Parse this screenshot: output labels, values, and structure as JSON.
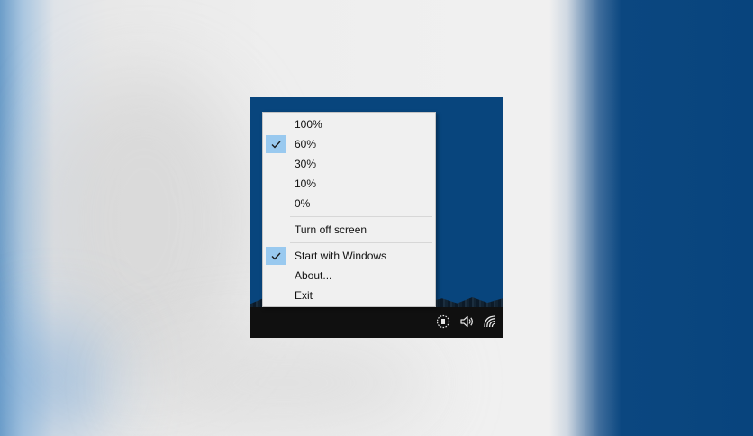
{
  "context_menu": {
    "brightness_options": [
      {
        "label": "100%",
        "checked": false
      },
      {
        "label": "60%",
        "checked": true
      },
      {
        "label": "30%",
        "checked": false
      },
      {
        "label": "10%",
        "checked": false
      },
      {
        "label": "0%",
        "checked": false
      }
    ],
    "turn_off_screen": {
      "label": "Turn off screen"
    },
    "start_with_windows": {
      "label": "Start with Windows",
      "checked": true
    },
    "about": {
      "label": "About..."
    },
    "exit": {
      "label": "Exit"
    }
  },
  "tray_icons": [
    "brightness-tray-icon",
    "speaker-icon",
    "wifi-icon"
  ],
  "colors": {
    "desktop": "#08457d",
    "taskbar": "#101010",
    "menu_bg": "#f0f0f0",
    "check_highlight": "#99c9ef"
  }
}
